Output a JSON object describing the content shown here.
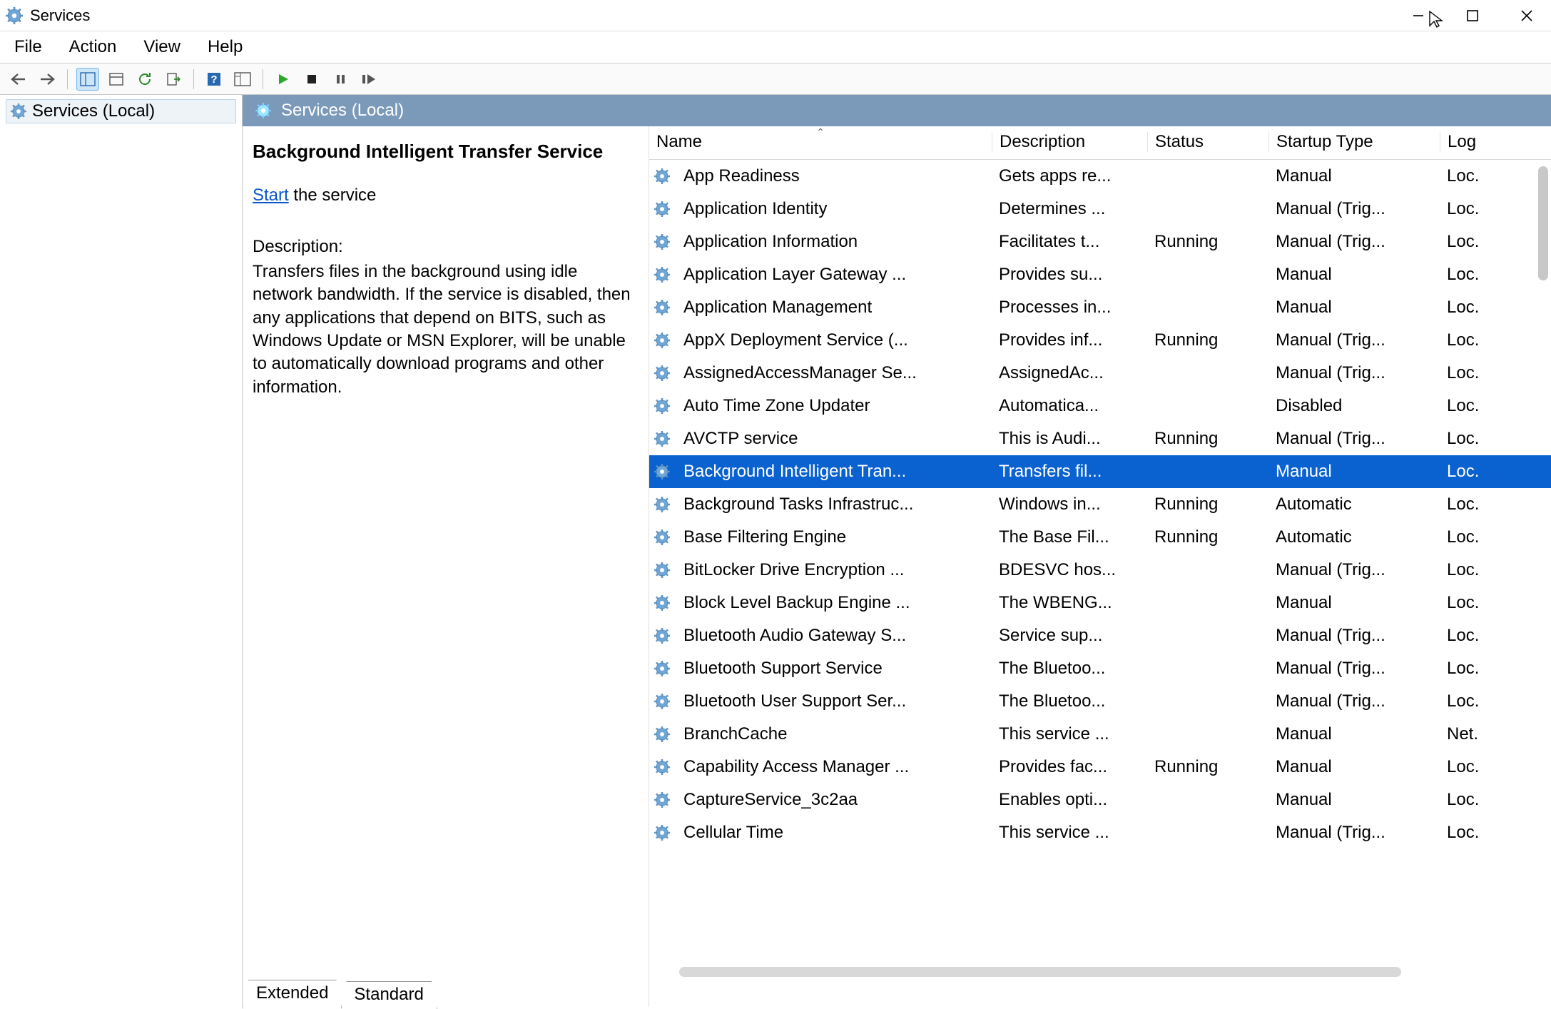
{
  "window": {
    "title": "Services"
  },
  "menu": {
    "file": "File",
    "action": "Action",
    "view": "View",
    "help": "Help"
  },
  "tree": {
    "root": "Services (Local)"
  },
  "pane": {
    "header": "Services (Local)"
  },
  "detail": {
    "title": "Background Intelligent Transfer Service",
    "start_link": "Start",
    "start_suffix": " the service",
    "desc_label": "Description:",
    "desc_text": "Transfers files in the background using idle network bandwidth. If the service is disabled, then any applications that depend on BITS, such as Windows Update or MSN Explorer, will be unable to automatically download programs and other information."
  },
  "columns": {
    "name": "Name",
    "description": "Description",
    "status": "Status",
    "startup": "Startup Type",
    "logon": "Log"
  },
  "tabs": {
    "extended": "Extended",
    "standard": "Standard"
  },
  "services": [
    {
      "name": "App Readiness",
      "desc": "Gets apps re...",
      "status": "",
      "startup": "Manual",
      "logon": "Loc."
    },
    {
      "name": "Application Identity",
      "desc": "Determines ...",
      "status": "",
      "startup": "Manual (Trig...",
      "logon": "Loc."
    },
    {
      "name": "Application Information",
      "desc": "Facilitates t...",
      "status": "Running",
      "startup": "Manual (Trig...",
      "logon": "Loc."
    },
    {
      "name": "Application Layer Gateway ...",
      "desc": "Provides su...",
      "status": "",
      "startup": "Manual",
      "logon": "Loc."
    },
    {
      "name": "Application Management",
      "desc": "Processes in...",
      "status": "",
      "startup": "Manual",
      "logon": "Loc."
    },
    {
      "name": "AppX Deployment Service (...",
      "desc": "Provides inf...",
      "status": "Running",
      "startup": "Manual (Trig...",
      "logon": "Loc."
    },
    {
      "name": "AssignedAccessManager Se...",
      "desc": "AssignedAc...",
      "status": "",
      "startup": "Manual (Trig...",
      "logon": "Loc."
    },
    {
      "name": "Auto Time Zone Updater",
      "desc": "Automatica...",
      "status": "",
      "startup": "Disabled",
      "logon": "Loc."
    },
    {
      "name": "AVCTP service",
      "desc": "This is Audi...",
      "status": "Running",
      "startup": "Manual (Trig...",
      "logon": "Loc."
    },
    {
      "name": "Background Intelligent Tran...",
      "desc": "Transfers fil...",
      "status": "",
      "startup": "Manual",
      "logon": "Loc.",
      "selected": true
    },
    {
      "name": "Background Tasks Infrastruc...",
      "desc": "Windows in...",
      "status": "Running",
      "startup": "Automatic",
      "logon": "Loc."
    },
    {
      "name": "Base Filtering Engine",
      "desc": "The Base Fil...",
      "status": "Running",
      "startup": "Automatic",
      "logon": "Loc."
    },
    {
      "name": "BitLocker Drive Encryption ...",
      "desc": "BDESVC hos...",
      "status": "",
      "startup": "Manual (Trig...",
      "logon": "Loc."
    },
    {
      "name": "Block Level Backup Engine ...",
      "desc": "The WBENG...",
      "status": "",
      "startup": "Manual",
      "logon": "Loc."
    },
    {
      "name": "Bluetooth Audio Gateway S...",
      "desc": "Service sup...",
      "status": "",
      "startup": "Manual (Trig...",
      "logon": "Loc."
    },
    {
      "name": "Bluetooth Support Service",
      "desc": "The Bluetoo...",
      "status": "",
      "startup": "Manual (Trig...",
      "logon": "Loc."
    },
    {
      "name": "Bluetooth User Support Ser...",
      "desc": "The Bluetoo...",
      "status": "",
      "startup": "Manual (Trig...",
      "logon": "Loc."
    },
    {
      "name": "BranchCache",
      "desc": "This service ...",
      "status": "",
      "startup": "Manual",
      "logon": "Net."
    },
    {
      "name": "Capability Access Manager ...",
      "desc": "Provides fac...",
      "status": "Running",
      "startup": "Manual",
      "logon": "Loc."
    },
    {
      "name": "CaptureService_3c2aa",
      "desc": "Enables opti...",
      "status": "",
      "startup": "Manual",
      "logon": "Loc."
    },
    {
      "name": "Cellular Time",
      "desc": "This service ...",
      "status": "",
      "startup": "Manual (Trig...",
      "logon": "Loc."
    }
  ]
}
